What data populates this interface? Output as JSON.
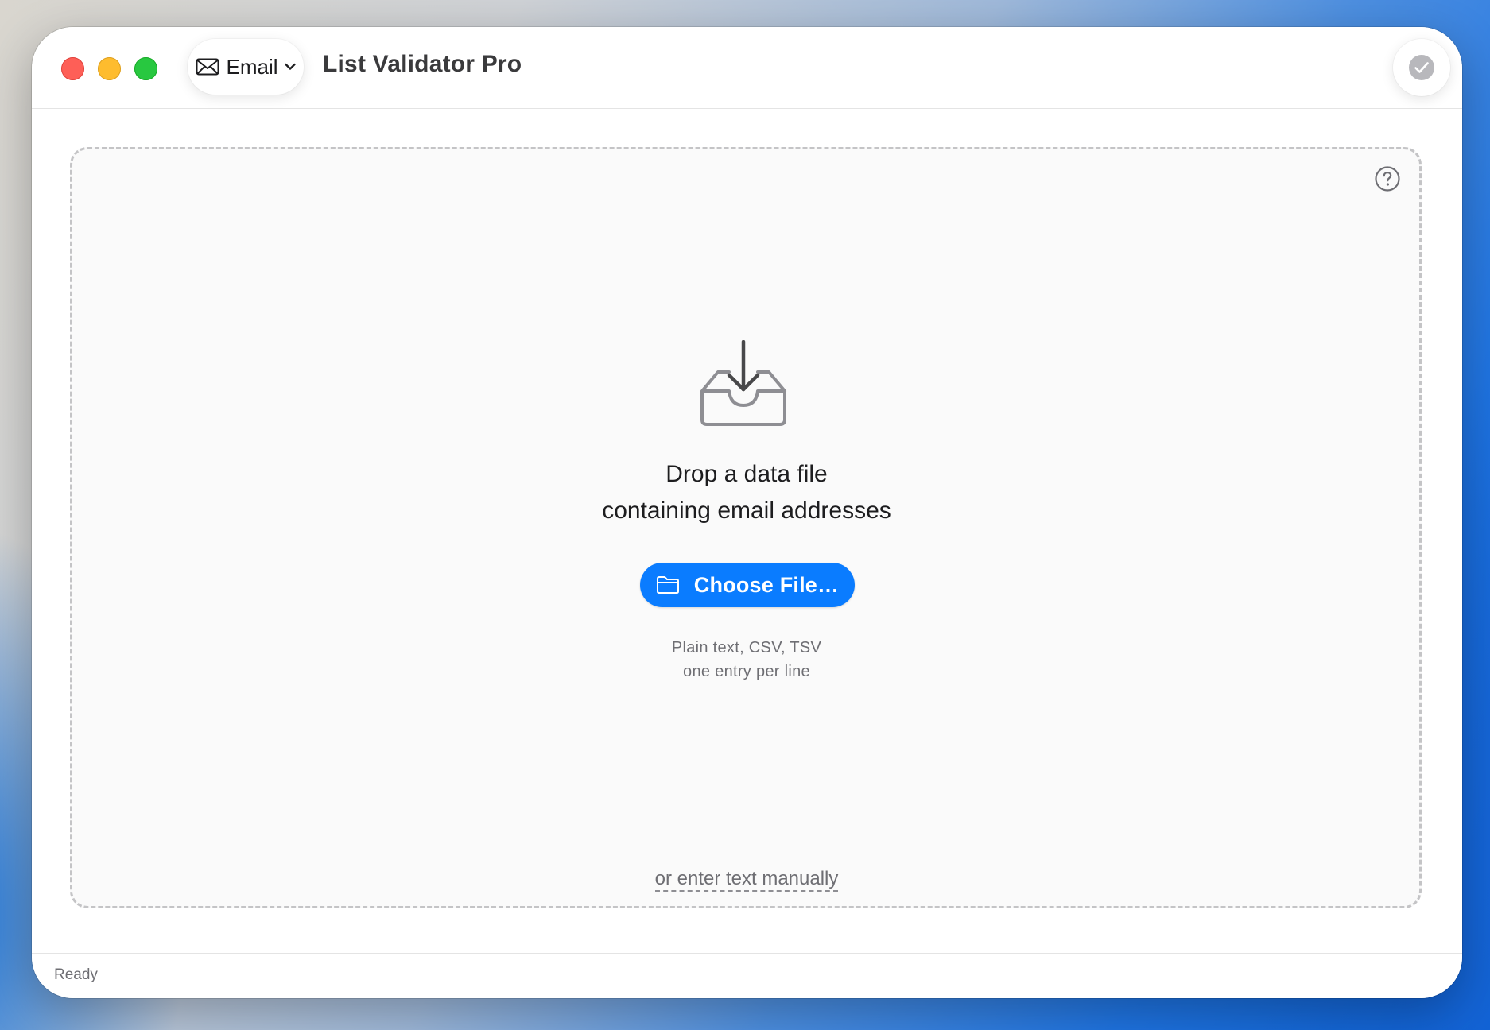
{
  "window": {
    "title": "List Validator Pro",
    "mode_menu": {
      "selected": "Email",
      "icon": "envelope-icon",
      "chevron": "chevron-down-icon"
    },
    "status_indicator": "checkmark-circle-icon"
  },
  "dropzone": {
    "icon": "tray-download-icon",
    "heading_line1": "Drop a data file",
    "heading_line2": "containing email addresses",
    "choose_button": {
      "label": "Choose File…",
      "icon": "folder-icon"
    },
    "formats_line1": "Plain text, CSV, TSV",
    "formats_line2": "one entry per line",
    "manual_link": "or enter text manually",
    "help_icon": "question-mark-circle-icon"
  },
  "status_bar": {
    "text": "Ready"
  },
  "colors": {
    "accent": "#0a7cff",
    "close": "#fe5f57",
    "minimize": "#febc2e",
    "maximize": "#28c840"
  }
}
